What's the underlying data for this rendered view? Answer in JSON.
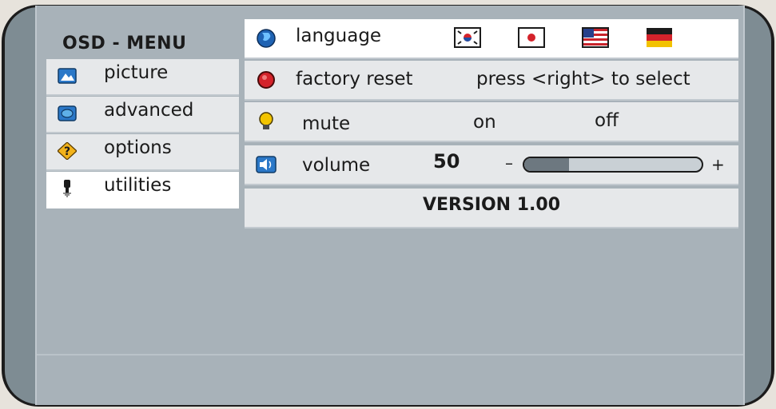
{
  "menu": {
    "title": "OSD - MENU"
  },
  "sidebar": {
    "items": [
      {
        "label": "picture",
        "icon": "picture-icon",
        "selected": false
      },
      {
        "label": "advanced",
        "icon": "advanced-icon",
        "selected": false
      },
      {
        "label": "options",
        "icon": "options-icon",
        "selected": false
      },
      {
        "label": "utilities",
        "icon": "utilities-icon",
        "selected": true
      }
    ]
  },
  "utilities": {
    "language": {
      "label": "language",
      "icon": "globe-icon",
      "flags": [
        "korea-flag-icon",
        "japan-flag-icon",
        "usa-flag-icon",
        "germany-flag-icon"
      ]
    },
    "factory_reset": {
      "label": "factory reset",
      "icon": "reset-icon",
      "hint": "press <right> to select"
    },
    "mute": {
      "label": "mute",
      "icon": "bulb-icon",
      "on_label": "on",
      "off_label": "off"
    },
    "volume": {
      "label": "volume",
      "icon": "speaker-icon",
      "value": "50",
      "minus": "–",
      "plus": "+",
      "level": 0.25
    },
    "version": "VERSION 1.00"
  },
  "colors": {
    "frame": "#1c1c1c",
    "panel": "#a8b2b9",
    "row": "#e6e8ea",
    "selected": "#ffffff",
    "icon_blue": "#2b78c8"
  }
}
